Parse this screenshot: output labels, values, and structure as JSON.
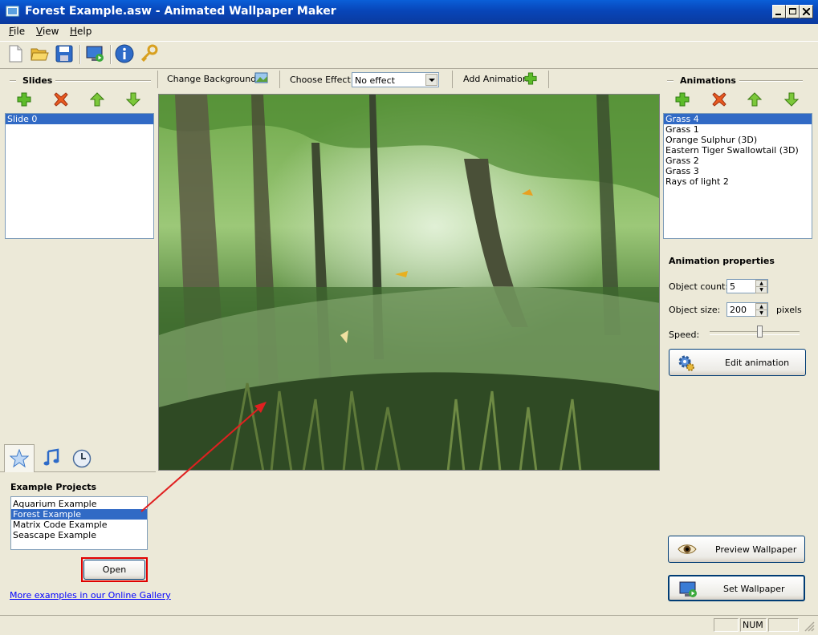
{
  "window": {
    "title": "Forest Example.asw - Animated Wallpaper Maker"
  },
  "menu": {
    "file": "File",
    "file_rest": "ile",
    "view": "View",
    "help": "Help"
  },
  "menu_keys": {
    "file": "F",
    "view": "V",
    "help": "H"
  },
  "menu_rest": {
    "file": "ile",
    "view": "iew",
    "help": "elp"
  },
  "toolbar": {
    "change_background": "Change Background",
    "choose_effect": "Choose Effect:",
    "effect_value": "No effect",
    "add_animation": "Add Animation"
  },
  "slides": {
    "title": "Slides",
    "items": [
      "Slide 0"
    ],
    "selected": 0
  },
  "animations": {
    "title": "Animations",
    "items": [
      "Grass 4",
      "Grass 1",
      "Orange Sulphur (3D)",
      "Eastern Tiger Swallowtail (3D)",
      "Grass 2",
      "Grass 3",
      "Rays of light 2"
    ],
    "selected": 0
  },
  "animation_properties": {
    "title": "Animation properties",
    "object_count_label": "Object count:",
    "object_count": "5",
    "object_size_label": "Object size:",
    "object_size": "200",
    "pixels_label": "pixels",
    "speed_label": "Speed:",
    "speed_value": 0.55,
    "edit_button": "Edit animation"
  },
  "examples": {
    "title": "Example Projects",
    "items": [
      "Aquarium Example",
      "Forest Example",
      "Matrix Code Example",
      "Seascape Example"
    ],
    "selected": 1,
    "open_button": "Open",
    "gallery_link": "More examples in our Online Gallery"
  },
  "actions": {
    "preview": "Preview Wallpaper",
    "set": "Set Wallpaper"
  },
  "statusbar": {
    "num": "NUM"
  },
  "colors": {
    "selection": "#316AC5",
    "titlebar": "#0845B8",
    "highlight_box": "#E00000",
    "arrow": "#E02020"
  }
}
